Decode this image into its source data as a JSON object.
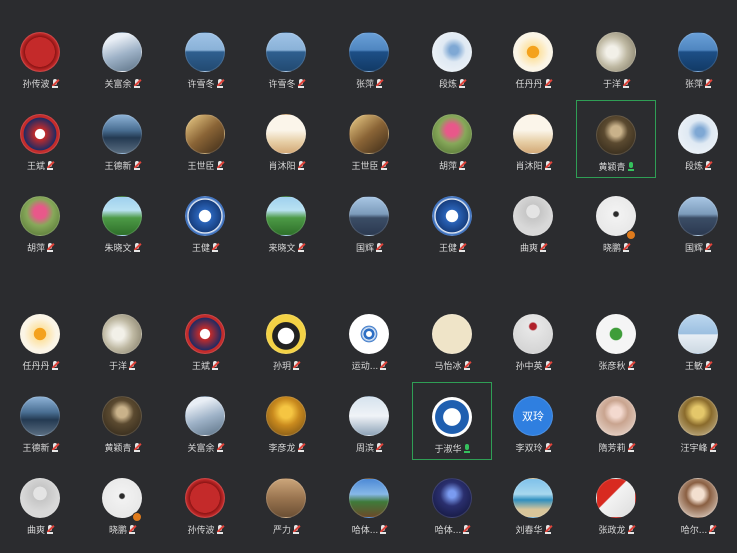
{
  "colors": {
    "background": "#2b2c2f",
    "active_border": "#2f9e55",
    "mic_muted": "#e0443b",
    "mic_speaking": "#35c15d"
  },
  "top_grid": [
    [
      {
        "name": "孙传波",
        "avatar": "seal-red",
        "mic": "muted"
      },
      {
        "name": "关富余",
        "avatar": "snow",
        "mic": "muted"
      },
      {
        "name": "许雪冬",
        "avatar": "sea",
        "mic": "muted"
      },
      {
        "name": "许雪冬",
        "avatar": "sea",
        "mic": "muted"
      },
      {
        "name": "张萍",
        "avatar": "sea-blue",
        "mic": "muted"
      },
      {
        "name": "段炼",
        "avatar": "dragon",
        "mic": "muted"
      },
      {
        "name": "任丹丹",
        "avatar": "sun",
        "mic": "muted"
      },
      {
        "name": "于洋",
        "avatar": "flowers",
        "mic": "muted"
      },
      {
        "name": "张萍",
        "avatar": "sea-blue",
        "mic": "muted"
      }
    ],
    [
      {
        "name": "王斌",
        "avatar": "emblem-red",
        "mic": "muted"
      },
      {
        "name": "王德新",
        "avatar": "harbor",
        "mic": "muted"
      },
      {
        "name": "王世臣",
        "avatar": "rock",
        "mic": "muted"
      },
      {
        "name": "肖沐阳",
        "avatar": "mountain-pale",
        "mic": "muted"
      },
      {
        "name": "王世臣",
        "avatar": "rock",
        "mic": "muted"
      },
      {
        "name": "胡萍",
        "avatar": "lotus",
        "mic": "muted"
      },
      {
        "name": "肖沐阳",
        "avatar": "mountain-pale",
        "mic": "muted"
      },
      {
        "name": "黄颖青",
        "avatar": "portrait-dark",
        "mic": "speaking",
        "active": true
      },
      {
        "name": "段炼",
        "avatar": "dragon",
        "mic": "muted"
      }
    ],
    [
      {
        "name": "胡萍",
        "avatar": "lotus",
        "mic": "muted"
      },
      {
        "name": "朱晓文",
        "avatar": "green-field",
        "mic": "muted"
      },
      {
        "name": "王健",
        "avatar": "badge-blue",
        "mic": "muted"
      },
      {
        "name": "来晓文",
        "avatar": "green-field",
        "mic": "muted"
      },
      {
        "name": "国辉",
        "avatar": "city",
        "mic": "muted"
      },
      {
        "name": "王健",
        "avatar": "badge-blue",
        "mic": "muted"
      },
      {
        "name": "曲爽",
        "avatar": "placeholder",
        "mic": "muted"
      },
      {
        "name": "晓鹏",
        "avatar": "bird",
        "mic": "muted",
        "badge": true
      },
      {
        "name": "国辉",
        "avatar": "city",
        "mic": "muted"
      }
    ]
  ],
  "bottom_grid": [
    [
      {
        "name": "任丹丹",
        "avatar": "sun",
        "mic": "muted"
      },
      {
        "name": "于洋",
        "avatar": "flowers",
        "mic": "muted"
      },
      {
        "name": "王斌",
        "avatar": "emblem-red",
        "mic": "muted"
      },
      {
        "name": "孙玥",
        "avatar": "cartoon",
        "mic": "muted"
      },
      {
        "name": "运动...",
        "avatar": "wifi",
        "mic": "muted"
      },
      {
        "name": "马怡冰",
        "avatar": "calligraphy",
        "mic": "muted"
      },
      {
        "name": "孙中英",
        "avatar": "rose",
        "mic": "muted"
      },
      {
        "name": "张彦秋",
        "avatar": "clover",
        "mic": "muted"
      },
      {
        "name": "王敏",
        "avatar": "pier",
        "mic": "muted"
      }
    ],
    [
      {
        "name": "王德新",
        "avatar": "harbor",
        "mic": "muted"
      },
      {
        "name": "黄颖青",
        "avatar": "portrait-dark",
        "mic": "muted"
      },
      {
        "name": "关富余",
        "avatar": "snow",
        "mic": "muted"
      },
      {
        "name": "李彦龙",
        "avatar": "autumn",
        "mic": "muted"
      },
      {
        "name": "周滨",
        "avatar": "person-snow",
        "mic": "muted"
      },
      {
        "name": "于淑华",
        "avatar": "logo-19",
        "mic": "speaking",
        "active": true
      },
      {
        "name": "李双玲",
        "avatar": "text-blue",
        "text": "双玲",
        "mic": "muted"
      },
      {
        "name": "隋芳莉",
        "avatar": "girl",
        "mic": "muted"
      },
      {
        "name": "汪宇峰",
        "avatar": "tree",
        "mic": "muted"
      }
    ],
    [
      {
        "name": "曲爽",
        "avatar": "placeholder",
        "mic": "muted"
      },
      {
        "name": "晓鹏",
        "avatar": "bird",
        "mic": "muted",
        "badge": true
      },
      {
        "name": "孙传波",
        "avatar": "seal-red",
        "mic": "muted"
      },
      {
        "name": "严力",
        "avatar": "wood",
        "mic": "muted"
      },
      {
        "name": "哈体...",
        "avatar": "landscape",
        "mic": "muted"
      },
      {
        "name": "哈体...",
        "avatar": "stage",
        "mic": "muted"
      },
      {
        "name": "刘春华",
        "avatar": "beach",
        "mic": "muted"
      },
      {
        "name": "张政龙",
        "avatar": "flag",
        "mic": "muted"
      },
      {
        "name": "哈尔...",
        "avatar": "woman",
        "mic": "muted"
      }
    ]
  ]
}
